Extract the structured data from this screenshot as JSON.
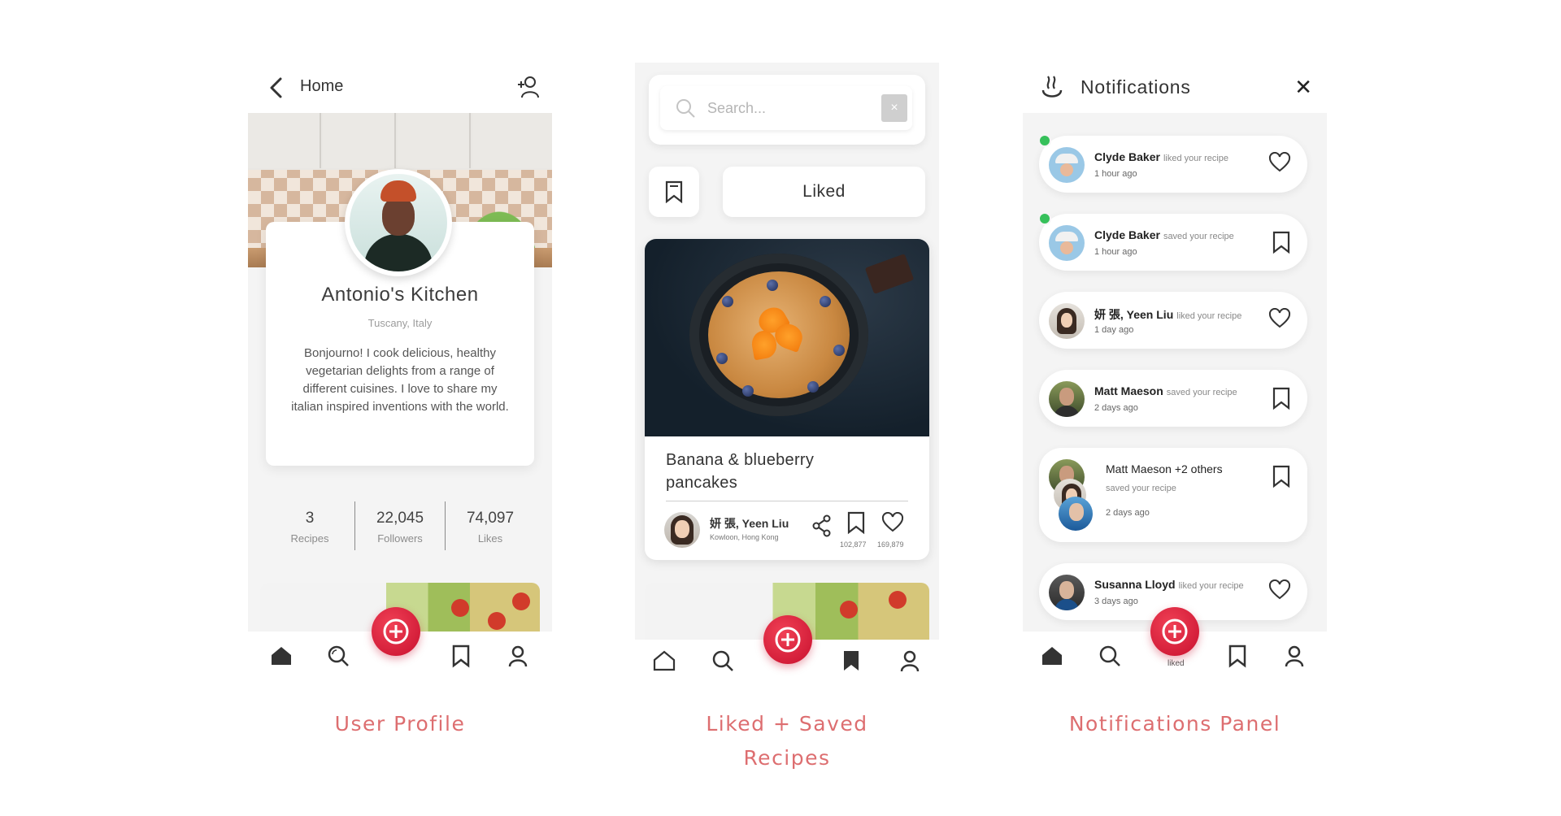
{
  "captions": {
    "profile": "User Profile",
    "liked_line1": "Liked + Saved",
    "liked_line2": "Recipes",
    "notifications": "Notifications Panel"
  },
  "profile": {
    "header_title": "Home",
    "name": "Antonio's Kitchen",
    "location": "Tuscany, Italy",
    "bio": "Bonjourno! I cook delicious, healthy vegetarian delights from a range of different cuisines. I love to share my italian inspired inventions with the world.",
    "stats": [
      {
        "value": "3",
        "label": "Recipes"
      },
      {
        "value": "22,045",
        "label": "Followers"
      },
      {
        "value": "74,097",
        "label": "Likes"
      }
    ]
  },
  "liked": {
    "search_placeholder": "Search...",
    "clear_symbol": "×",
    "filter_label": "Liked",
    "recipe": {
      "title": "Banana & blueberry pancakes",
      "author": "妍 張, Yeen Liu",
      "author_location": "Kowloon, Hong Kong",
      "saves": "102,877",
      "likes": "169,879"
    }
  },
  "notifications": {
    "title": "Notifications",
    "close_symbol": "✕",
    "items": [
      {
        "name": "Clyde Baker",
        "action": "liked your recipe",
        "time": "1 hour ago",
        "type": "like",
        "unread": true
      },
      {
        "name": "Clyde Baker",
        "action": "saved your recipe",
        "time": "1 hour ago",
        "type": "save",
        "unread": true
      },
      {
        "name": "妍 張, Yeen Liu",
        "action": "liked your recipe",
        "time": "1 day ago",
        "type": "like",
        "unread": false
      },
      {
        "name": "Matt Maeson",
        "action": "saved your recipe",
        "time": "2 days ago",
        "type": "save",
        "unread": false
      },
      {
        "name": "Matt Maeson +2 others",
        "action": "saved your recipe",
        "time": "2 days ago",
        "type": "save",
        "unread": false
      },
      {
        "name": "Susanna Lloyd",
        "action": "liked your recipe",
        "time": "3 days ago",
        "type": "like",
        "unread": false
      }
    ],
    "tab_caption": "liked"
  },
  "colors": {
    "accent": "#dd6e70",
    "fab": "#d9193a",
    "unread_dot": "#36c05a"
  }
}
